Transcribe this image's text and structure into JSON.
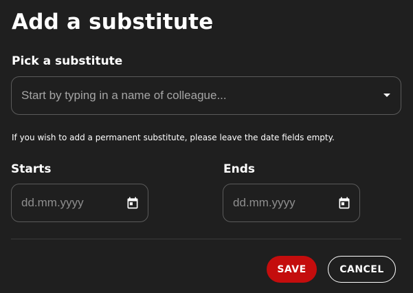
{
  "dialog": {
    "title": "Add a substitute",
    "substitute": {
      "label": "Pick a substitute",
      "placeholder": "Start by typing in a name of colleague...",
      "icon": "caret-down-icon"
    },
    "hint": "If you wish to add a permanent substitute, please leave the date fields empty.",
    "starts": {
      "label": "Starts",
      "placeholder": "dd.mm.yyyy",
      "icon": "calendar-icon"
    },
    "ends": {
      "label": "Ends",
      "placeholder": "dd.mm.yyyy",
      "icon": "calendar-icon"
    },
    "actions": {
      "save_label": "SAVE",
      "cancel_label": "CANCEL"
    },
    "colors": {
      "background": "#1f1f1f",
      "primary": "#c40d0d",
      "border": "#5b5b5b",
      "placeholder": "#a6a6a6"
    }
  }
}
